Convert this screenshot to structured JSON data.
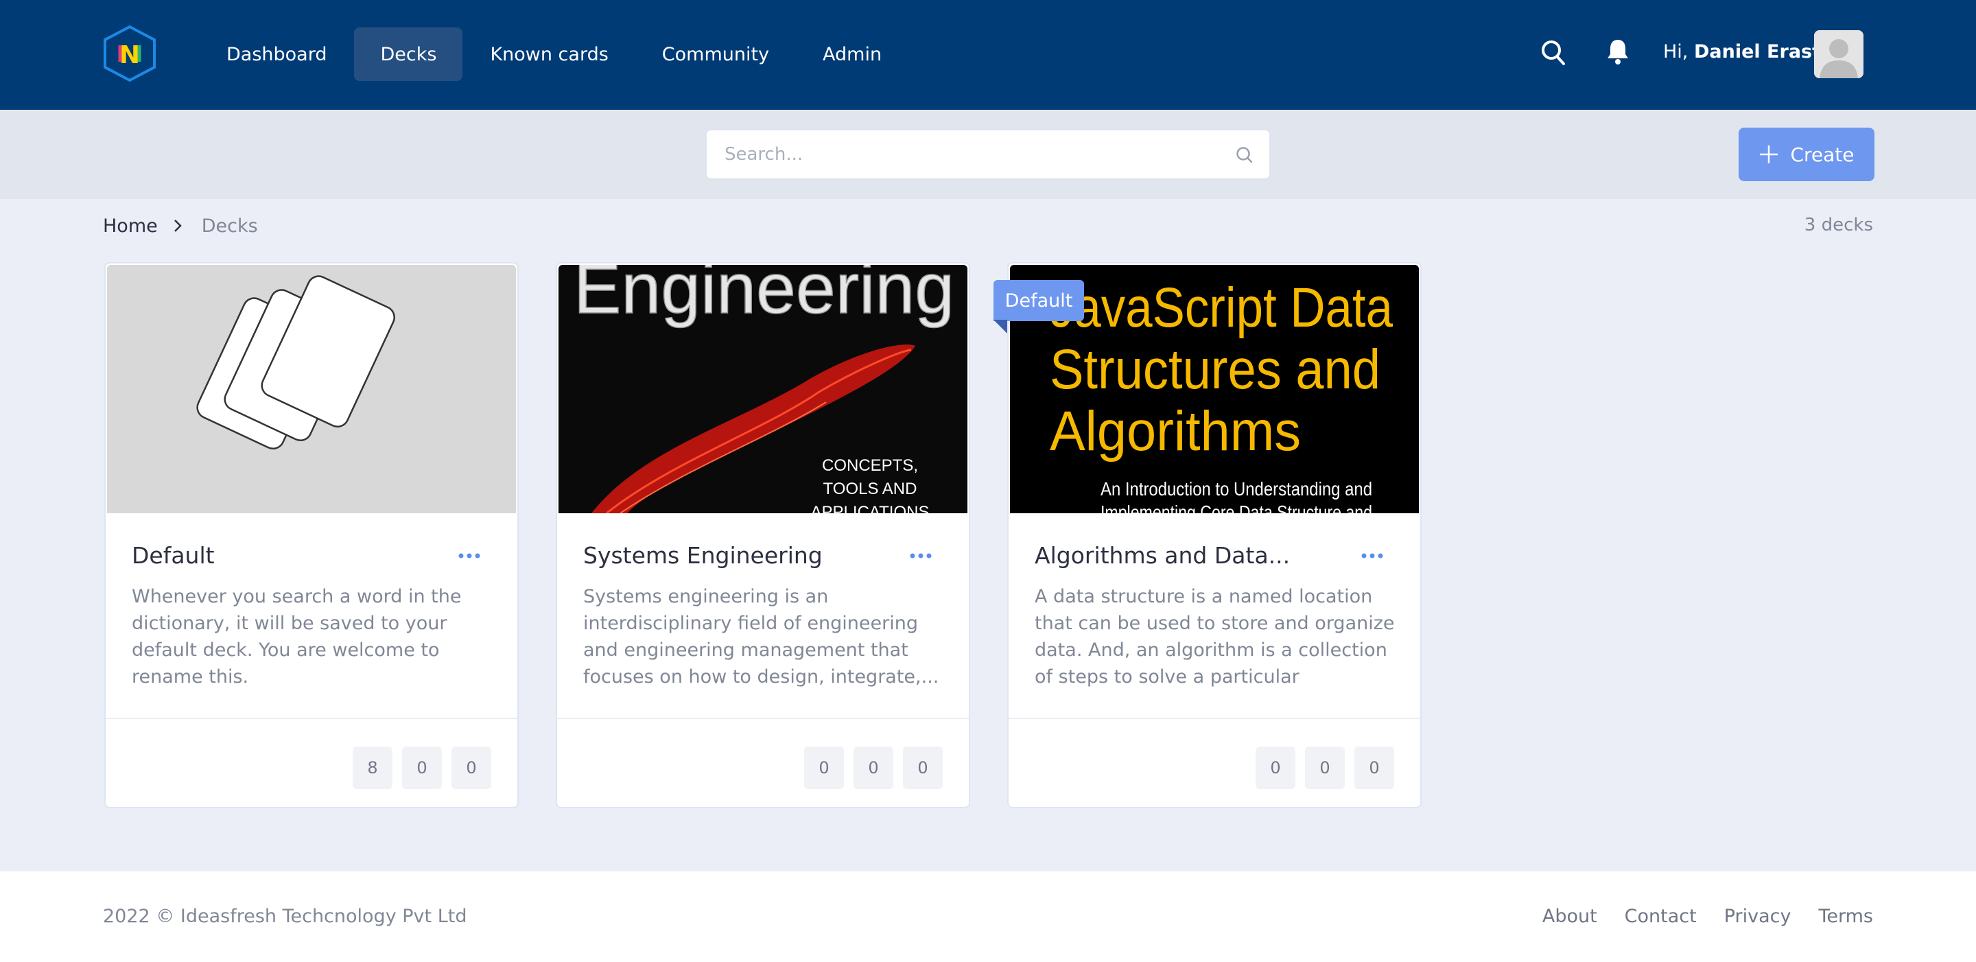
{
  "header": {
    "logo_letter": "N",
    "nav": [
      "Dashboard",
      "Decks",
      "Known cards",
      "Community",
      "Admin"
    ],
    "active_nav": "Decks",
    "greeting_prefix": "Hi,",
    "user_name": "Daniel Erast",
    "icons": [
      "search-icon",
      "bell-icon",
      "avatar"
    ]
  },
  "toolbar": {
    "search_placeholder": "Search...",
    "create_label": "Create"
  },
  "breadcrumb": {
    "home": "Home",
    "current": "Decks"
  },
  "deck_count": "3 decks",
  "decks": [
    {
      "title": "Default",
      "description": "Whenever you search a word in the dictionary, it will be saved to your default deck. You are welcome to rename this.",
      "stats": [
        "8",
        "0",
        "0"
      ],
      "badge": ""
    },
    {
      "title": "Systems Engineering",
      "description": "Systems engineering is an interdisciplinary field of engineering and engineering management that focuses on how to design, integrate,...",
      "stats": [
        "0",
        "0",
        "0"
      ],
      "cover_text": "Engineering",
      "cover_subtext": [
        "CONCEPTS,",
        "TOOLS AND",
        "APPLICATIONS"
      ],
      "badge": ""
    },
    {
      "title": "Algorithms and Data...",
      "description": "A data structure is a named location that can be used to store and organize data. And, an algorithm is a collection of steps to solve a particular problem....",
      "stats": [
        "0",
        "0",
        "0"
      ],
      "cover_text": [
        "JavaScript Data",
        "Structures and",
        "Algorithms"
      ],
      "cover_subtext": [
        "An Introduction to Understanding and",
        "Implementing Core Data Structure and"
      ],
      "badge": "Default"
    }
  ],
  "footer": {
    "copyright": "2022 © Ideasfresh Techcnology Pvt Ltd",
    "links": [
      "About",
      "Contact",
      "Privacy",
      "Terms"
    ]
  },
  "colors": {
    "header_bg": "#003b75",
    "active_nav_bg": "#254f81",
    "accent": "#6e97ef",
    "page_bg": "#ebeef6",
    "js_cover_yellow": "#f6b900"
  }
}
